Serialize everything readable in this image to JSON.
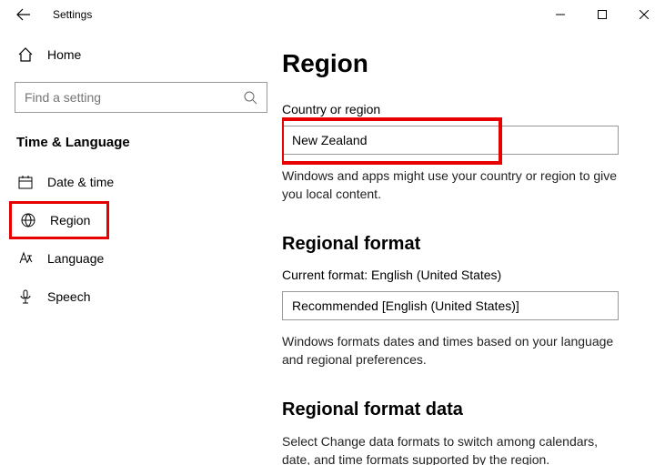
{
  "titlebar": {
    "title": "Settings"
  },
  "sidebar": {
    "home": "Home",
    "search_placeholder": "Find a setting",
    "category": "Time & Language",
    "items": [
      {
        "label": "Date & time"
      },
      {
        "label": "Region"
      },
      {
        "label": "Language"
      },
      {
        "label": "Speech"
      }
    ]
  },
  "main": {
    "heading": "Region",
    "country_label": "Country or region",
    "country_value": "New Zealand",
    "country_note": "Windows and apps might use your country or region to give you local content.",
    "format_heading": "Regional format",
    "format_current": "Current format: English (United States)",
    "format_value": "Recommended [English (United States)]",
    "format_note": "Windows formats dates and times based on your language and regional preferences.",
    "data_heading": "Regional format data",
    "data_note": "Select Change data formats to switch among calendars, date, and time formats supported by the region."
  }
}
